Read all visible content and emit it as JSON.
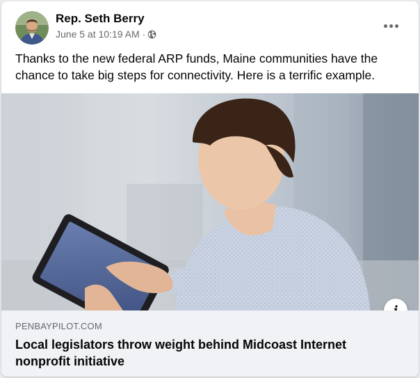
{
  "post": {
    "author_name": "Rep. Seth Berry",
    "timestamp": "June 5 at 10:19 AM",
    "separator": "·",
    "privacy_icon": "globe-icon",
    "more_icon": "more-options-icon",
    "text": "Thanks to the new federal ARP funds, Maine communities have the chance to take big steps for connectivity.  Here is a terrific example."
  },
  "link_preview": {
    "domain": "PENBAYPILOT.COM",
    "headline": "Local legislators throw weight behind Midcoast Internet nonprofit initiative",
    "info_icon_glyph": "i"
  },
  "colors": {
    "secondary_text": "#65676b",
    "primary_text": "#050505",
    "link_box_bg": "#f0f2f5"
  }
}
